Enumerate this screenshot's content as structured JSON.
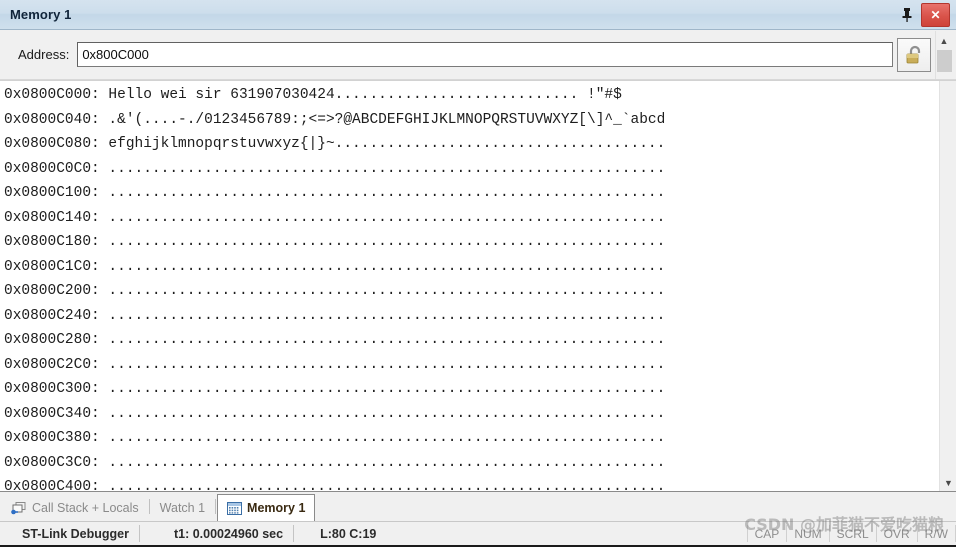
{
  "window": {
    "title": "Memory 1",
    "pin_icon": "pin-icon",
    "close_label": "✕"
  },
  "toolbar": {
    "address_label": "Address:",
    "address_value": "0x800C000",
    "address_placeholder": "",
    "lock_icon": "unlocked-padlock-icon"
  },
  "scrollbar": {
    "up_arrow": "▲",
    "down_arrow": "▼"
  },
  "memory": {
    "rows": [
      {
        "addr": "0x0800C000:",
        "bytes": " Hello wei sir 631907030424............................ !\"#$"
      },
      {
        "addr": "0x0800C040:",
        "bytes": " .&'(....-./0123456789:;<=>?@ABCDEFGHIJKLMNOPQRSTUVWXYZ[\\]^_`abcd"
      },
      {
        "addr": "0x0800C080:",
        "bytes": " efghijklmnopqrstuvwxyz{|}~......................................"
      },
      {
        "addr": "0x0800C0C0:",
        "bytes": " ................................................................"
      },
      {
        "addr": "0x0800C100:",
        "bytes": " ................................................................"
      },
      {
        "addr": "0x0800C140:",
        "bytes": " ................................................................"
      },
      {
        "addr": "0x0800C180:",
        "bytes": " ................................................................"
      },
      {
        "addr": "0x0800C1C0:",
        "bytes": " ................................................................"
      },
      {
        "addr": "0x0800C200:",
        "bytes": " ................................................................"
      },
      {
        "addr": "0x0800C240:",
        "bytes": " ................................................................"
      },
      {
        "addr": "0x0800C280:",
        "bytes": " ................................................................"
      },
      {
        "addr": "0x0800C2C0:",
        "bytes": " ................................................................"
      },
      {
        "addr": "0x0800C300:",
        "bytes": " ................................................................"
      },
      {
        "addr": "0x0800C340:",
        "bytes": " ................................................................"
      },
      {
        "addr": "0x0800C380:",
        "bytes": " ................................................................"
      },
      {
        "addr": "0x0800C3C0:",
        "bytes": " ................................................................"
      },
      {
        "addr": "0x0800C400:",
        "bytes": " ................................................................"
      }
    ]
  },
  "tabs": [
    {
      "label": "Call Stack + Locals",
      "icon": "call-stack-icon",
      "active": false
    },
    {
      "label": "Watch 1",
      "icon": "",
      "active": false
    },
    {
      "label": "Memory 1",
      "icon": "memory-grid-icon",
      "active": true
    }
  ],
  "status": {
    "debugger": "ST-Link Debugger",
    "time": "t1: 0.00024960 sec",
    "cursor": "L:80 C:19",
    "flags": [
      "CAP",
      "NUM",
      "SCRL",
      "OVR",
      "R/W"
    ]
  },
  "watermark": {
    "text": "CSDN @加菲猫不爱吃猫粮"
  },
  "colors": {
    "titlebar": "#c9dbea",
    "close_button": "#d9534a",
    "active_tab_text": "#3a2a12",
    "inactive_tab_text": "#8a8a8a",
    "hex_text": "#1d1d1d"
  }
}
